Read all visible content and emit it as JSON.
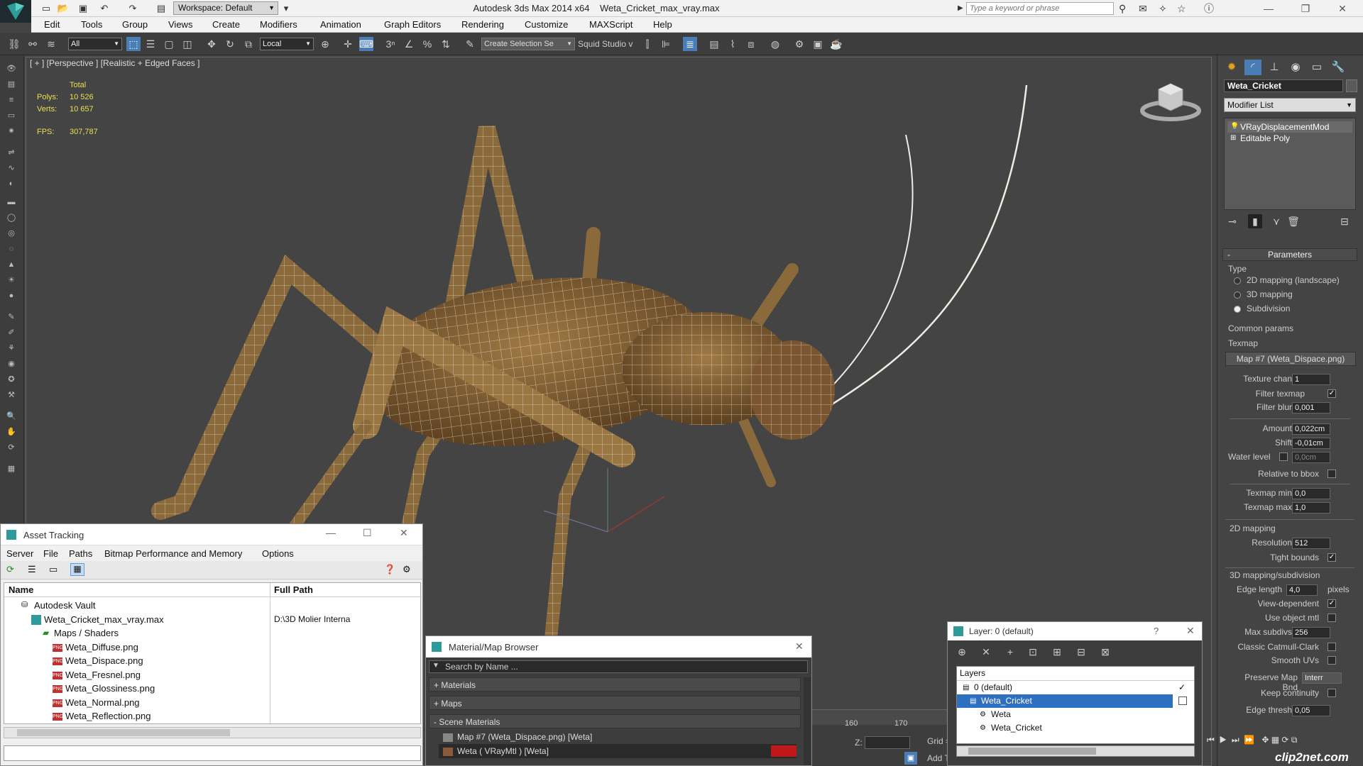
{
  "app": {
    "title": "Autodesk 3ds Max  2014 x64",
    "file": "Weta_Cricket_max_vray.max",
    "workspace": "Workspace: Default",
    "search_placeholder": "Type a keyword or phrase"
  },
  "menu": [
    "Edit",
    "Tools",
    "Group",
    "Views",
    "Create",
    "Modifiers",
    "Animation",
    "Graph Editors",
    "Rendering",
    "Customize",
    "MAXScript",
    "Help"
  ],
  "toolbar": {
    "filter": "All",
    "coord": "Local",
    "selection_set": "Create Selection Se",
    "squid": "Squid Studio v"
  },
  "viewport": {
    "label": "[ + ] [Perspective ] [Realistic + Edged Faces ]",
    "stats": {
      "total_label": "Total",
      "polys_label": "Polys:",
      "polys": "10 526",
      "verts_label": "Verts:",
      "verts": "10 657",
      "fps_label": "FPS:",
      "fps": "307,787"
    }
  },
  "command_panel": {
    "object_name": "Weta_Cricket",
    "modifier_list": "Modifier List",
    "stack": [
      "VRayDisplacementMod",
      "Editable Poly"
    ],
    "parameters_title": "Parameters",
    "type_label": "Type",
    "type_options": [
      "2D mapping (landscape)",
      "3D mapping",
      "Subdivision"
    ],
    "common_params": "Common params",
    "texmap_label": "Texmap",
    "texmap_value": "Map #7 (Weta_Dispace.png)",
    "texture_chan_label": "Texture chan",
    "texture_chan": "1",
    "filter_texmap_label": "Filter texmap",
    "filter_blur_label": "Filter blur",
    "filter_blur": "0,001",
    "amount_label": "Amount",
    "amount": "0,022cm",
    "shift_label": "Shift",
    "shift": "-0,01cm",
    "water_level_label": "Water level",
    "water_level": "0,0cm",
    "relative_bbox_label": "Relative to bbox",
    "texmap_min_label": "Texmap min",
    "texmap_min": "0,0",
    "texmap_max_label": "Texmap max",
    "texmap_max": "1,0",
    "mapping2d_label": "2D mapping",
    "resolution_label": "Resolution",
    "resolution": "512",
    "tight_bounds_label": "Tight bounds",
    "mapping3d_label": "3D mapping/subdivision",
    "edge_length_label": "Edge length",
    "edge_length": "4,0",
    "pixels_label": "pixels",
    "view_dependent_label": "View-dependent",
    "use_object_mtl_label": "Use object mtl",
    "max_subdivs_label": "Max subdivs",
    "max_subdivs": "256",
    "classic_catmull_label": "Classic Catmull-Clark",
    "smooth_uvs_label": "Smooth UVs",
    "preserve_map_bnd_label": "Preserve Map Bnd",
    "preserve_map_bnd": "Interr",
    "keep_continuity_label": "Keep continuity",
    "edge_thresh_label": "Edge thresh",
    "edge_thresh": "0,05"
  },
  "asset_tracking": {
    "title": "Asset Tracking",
    "menus": [
      "Server",
      "File",
      "Paths",
      "Bitmap Performance and Memory",
      "Options"
    ],
    "columns": [
      "Name",
      "Full Path"
    ],
    "rows": [
      {
        "name": "Autodesk Vault",
        "path": ""
      },
      {
        "name": "Weta_Cricket_max_vray.max",
        "path": "D:\\3D Molier Interna"
      },
      {
        "name": "Maps / Shaders",
        "path": ""
      },
      {
        "name": "Weta_Diffuse.png",
        "path": ""
      },
      {
        "name": "Weta_Dispace.png",
        "path": ""
      },
      {
        "name": "Weta_Fresnel.png",
        "path": ""
      },
      {
        "name": "Weta_Glossiness.png",
        "path": ""
      },
      {
        "name": "Weta_Normal.png",
        "path": ""
      },
      {
        "name": "Weta_Reflection.png",
        "path": ""
      }
    ],
    "png_badge": "PNG"
  },
  "material_browser": {
    "title": "Material/Map Browser",
    "search_placeholder": "Search by Name ...",
    "groups": [
      "+ Materials",
      "+ Maps",
      "- Scene Materials"
    ],
    "items": [
      "Map #7 (Weta_Dispace.png)  [Weta]",
      "Weta  ( VRayMtl )  [Weta]"
    ]
  },
  "layer_window": {
    "title": "Layer: 0 (default)",
    "help": "?",
    "header": "Layers",
    "rows": [
      "0 (default)",
      "Weta_Cricket",
      "Weta",
      "Weta_Cricket"
    ]
  },
  "timeline": {
    "ticks": [
      "160",
      "170"
    ],
    "z_label": "Z:",
    "grid_label": "Grid =",
    "add_label": "Add T"
  },
  "watermark": "clip2net.com"
}
